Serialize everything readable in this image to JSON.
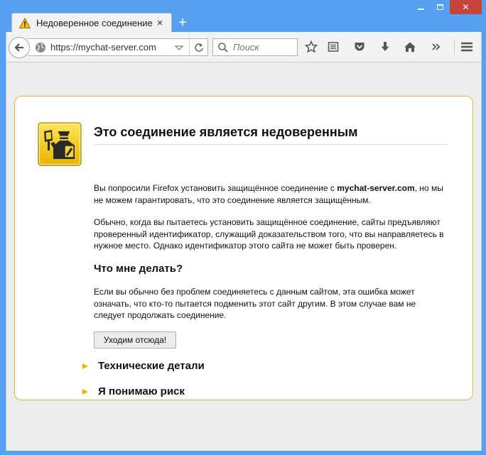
{
  "browser": {
    "tab": {
      "title": "Недоверенное соединение",
      "icon": "warning-icon",
      "close": "×"
    },
    "new_tab": "+",
    "window_controls": {
      "minimize": "minimize-icon",
      "maximize": "maximize-icon",
      "close": "✕"
    },
    "url": "https://mychat-server.com",
    "search_placeholder": "Поиск",
    "toolbar_icons": [
      "bookmark-star-icon",
      "reading-list-icon",
      "pocket-icon",
      "download-icon",
      "home-icon",
      "overflow-chevron-icon",
      "menu-icon"
    ]
  },
  "page": {
    "title": "Это соединение является недоверенным",
    "p1_before": "Вы попросили Firefox установить защищённое соединение с ",
    "p1_host": "mychat-server.com",
    "p1_after": ", но мы не можем гарантировать, что это соединение является защищённым.",
    "p2": "Обычно, когда вы пытаетесь установить защищённое соединение, сайты предъявляют проверенный идентификатор, служащий доказательством того, что вы направляетесь в нужное место. Однако идентификатор этого сайта не может быть проверен.",
    "what_to_do": "Что мне делать?",
    "p3": "Если вы обычно без проблем соединяетесь с данным сайтом, эта ошибка может означать, что кто-то пытается подменить этот сайт другим. В этом случае вам не следует продолжать соединение.",
    "leave_button": "Уходим отсюда!",
    "technical_details": "Технические детали",
    "understand_risks": "Я понимаю риск"
  },
  "colors": {
    "frame": "#55a0ef",
    "close_button": "#c7443b",
    "content_bg": "#ededed",
    "box_border": "#e9b43a",
    "arrow": "#f0b400"
  }
}
